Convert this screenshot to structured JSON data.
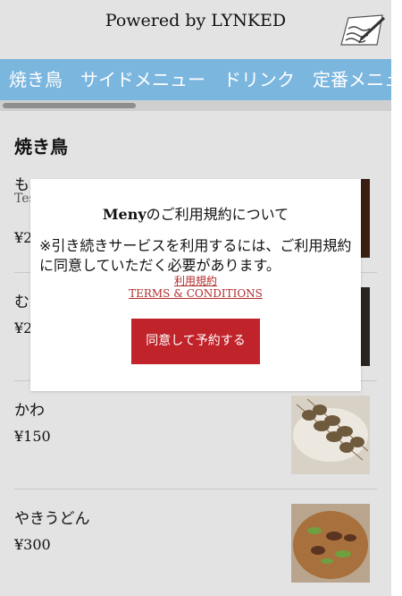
{
  "header": {
    "title": "Powered by LYNKED",
    "logo_icon": "notepad-pencil-icon"
  },
  "tabs": [
    {
      "label": "焼き鳥"
    },
    {
      "label": "サイドメニュー"
    },
    {
      "label": "ドリンク"
    },
    {
      "label": "定番メニュー"
    }
  ],
  "section": {
    "title": "焼き鳥"
  },
  "items": [
    {
      "name": "も",
      "desc": "Tes",
      "price": "¥2"
    },
    {
      "name": "む",
      "desc": "",
      "price": "¥2"
    },
    {
      "name": "かわ",
      "desc": "",
      "price": "¥150"
    },
    {
      "name": "やきうどん",
      "desc": "",
      "price": "¥300"
    }
  ],
  "dialog": {
    "title_brand": "Meny",
    "title_rest": "のご利用規約について",
    "body": "※引き続きサービスを利用するには、ご利用規約に同意していただく必要があります。",
    "link_terms_jp": "利用規約",
    "link_terms_en": "TERMS & CONDITIONS",
    "agree_button": "同意して予約する"
  },
  "colors": {
    "tab_bar": "#7bb6df",
    "accent_red": "#c0232a",
    "link_red": "#b32b2b",
    "page_bg": "#e3e3e3"
  }
}
